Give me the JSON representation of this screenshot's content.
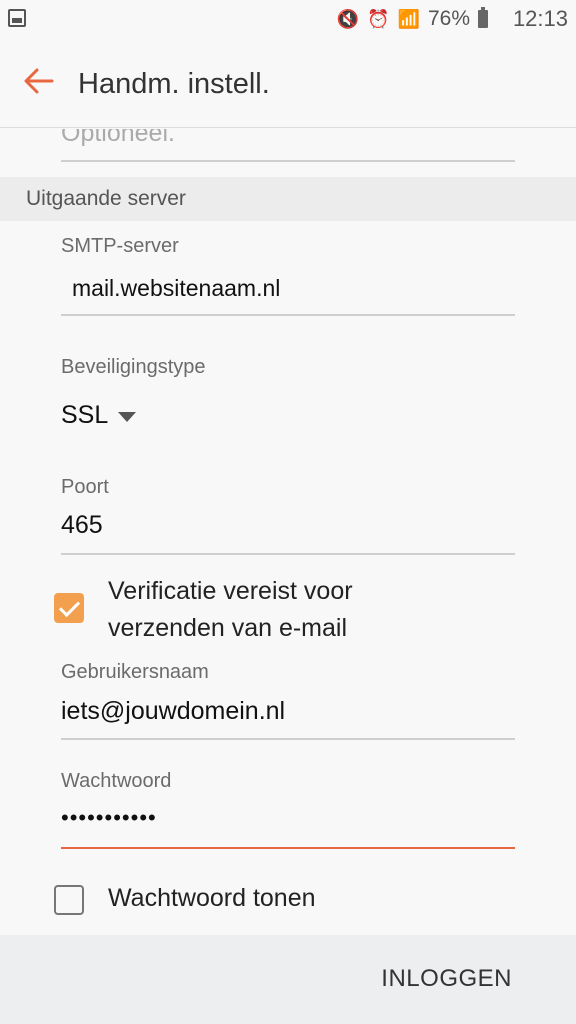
{
  "status": {
    "battery": "76%",
    "time": "12:13"
  },
  "appbar": {
    "title": "Handm. instell."
  },
  "form": {
    "optional_placeholder": "Optioneel.",
    "section_outgoing": "Uitgaande server",
    "smtp_label": "SMTP-server",
    "smtp_value": "mail.websitenaam.nl",
    "security_label": "Beveiligingstype",
    "security_value": "SSL",
    "port_label": "Poort",
    "port_value": "465",
    "auth_label": "Verificatie vereist voor verzenden van e-mail",
    "auth_checked": true,
    "username_label": "Gebruikersnaam",
    "username_value": "iets@jouwdomein.nl",
    "password_label": "Wachtwoord",
    "password_value": "•••••••••••",
    "show_password_label": "Wachtwoord tonen",
    "show_password_checked": false
  },
  "footer": {
    "login_label": "INLOGGEN"
  },
  "colors": {
    "accent": "#e8673f",
    "checkbox": "#f2a04e"
  }
}
